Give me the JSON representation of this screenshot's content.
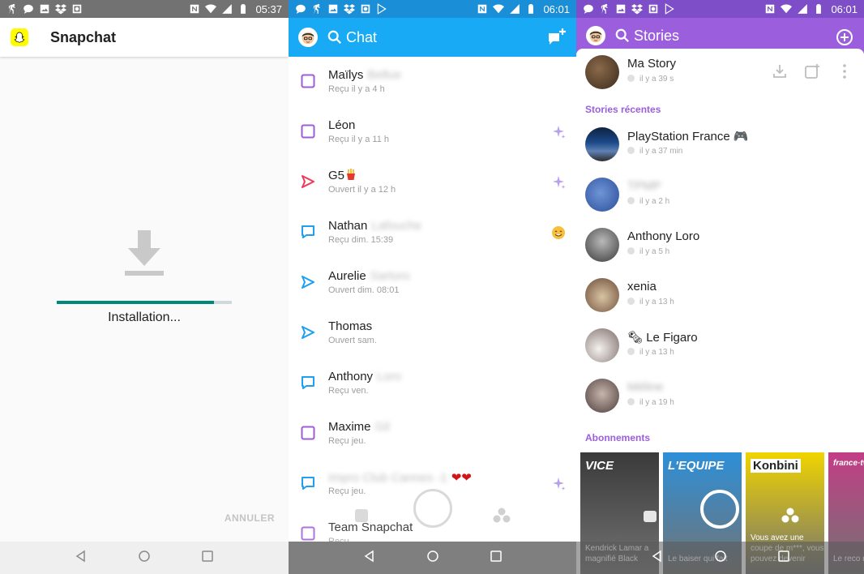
{
  "installer": {
    "status_time": "05:37",
    "app_title": "Snapchat",
    "progress": 0.9,
    "status_text": "Installation...",
    "cancel_label": "ANNULER"
  },
  "chat": {
    "status_time": "06:01",
    "title": "Chat",
    "rows": [
      {
        "name": "Maïlys",
        "surname": "Bellue",
        "subtitle": "Reçu il y a 4 h",
        "icon": "chat-square-purple",
        "badge": ""
      },
      {
        "name": "Léon",
        "surname": "",
        "subtitle": "Reçu il y a 11 h",
        "icon": "chat-square-purple",
        "badge": "sparkle-icon"
      },
      {
        "name": "G5",
        "surname": "",
        "subtitle": "Ouvert il y a 12 h",
        "icon": "sent-arrow-red",
        "badge": "sparkle-icon"
      },
      {
        "name": "Nathan",
        "surname": "Lafouche",
        "subtitle": "Reçu dim. 15:39",
        "icon": "chat-bubble-blue",
        "badge": "smile-emoji-icon"
      },
      {
        "name": "Aurelie",
        "surname": "Sartoro",
        "subtitle": "Ouvert dim. 08:01",
        "icon": "sent-arrow-blue",
        "badge": ""
      },
      {
        "name": "Thomas",
        "surname": "",
        "subtitle": "Ouvert sam.",
        "icon": "sent-arrow-blue",
        "badge": ""
      },
      {
        "name": "Anthony",
        "surname": "Loro",
        "subtitle": "Reçu ven.",
        "icon": "chat-bubble-blue",
        "badge": ""
      },
      {
        "name": "Maxime",
        "surname": "Gil",
        "subtitle": "Reçu jeu.",
        "icon": "chat-square-purple",
        "badge": ""
      },
      {
        "name": "Impro Club Cannes -1",
        "surname": "",
        "subtitle": "Reçu jeu.",
        "icon": "chat-bubble-blue",
        "badge": "sparkle-icon",
        "hearts": "❤❤"
      },
      {
        "name": "Team Snapchat",
        "surname": "",
        "subtitle": "Reçu...",
        "icon": "chat-square-purple",
        "badge": ""
      }
    ]
  },
  "stories": {
    "status_time": "06:01",
    "title": "Stories",
    "my_story": {
      "name": "Ma Story",
      "time": "il y a 39 s"
    },
    "recent_label": "Stories récentes",
    "recent": [
      {
        "name": "PlayStation France 🎮",
        "time": "il y a 37 min",
        "blurred": false
      },
      {
        "name": "TPMP",
        "time": "il y a 2 h",
        "blurred": true
      },
      {
        "name": "Anthony Loro",
        "time": "il y a 5 h",
        "blurred": false
      },
      {
        "name": "xenia",
        "time": "il y a 13 h",
        "blurred": false
      },
      {
        "name": "🗞 Le Figaro",
        "time": "il y a 13 h",
        "blurred": false
      },
      {
        "name": "Méline",
        "time": "il y a 19 h",
        "blurred": true
      }
    ],
    "subscriptions_label": "Abonnements",
    "discover": [
      {
        "brand": "VICE",
        "caption": "Kendrick Lamar a magnifié Black",
        "color": "#3a3a3a"
      },
      {
        "brand": "L'EQUIPE",
        "caption": "Le baiser qui fait",
        "color": "#2d8fd8"
      },
      {
        "brand": "Konbini",
        "caption": "Vous avez une coupe de m***, vous pouvez devenir",
        "color": "#f0d400"
      },
      {
        "brand": "france·tv",
        "caption": "Le reco monde",
        "color": "#c33d86"
      }
    ]
  }
}
